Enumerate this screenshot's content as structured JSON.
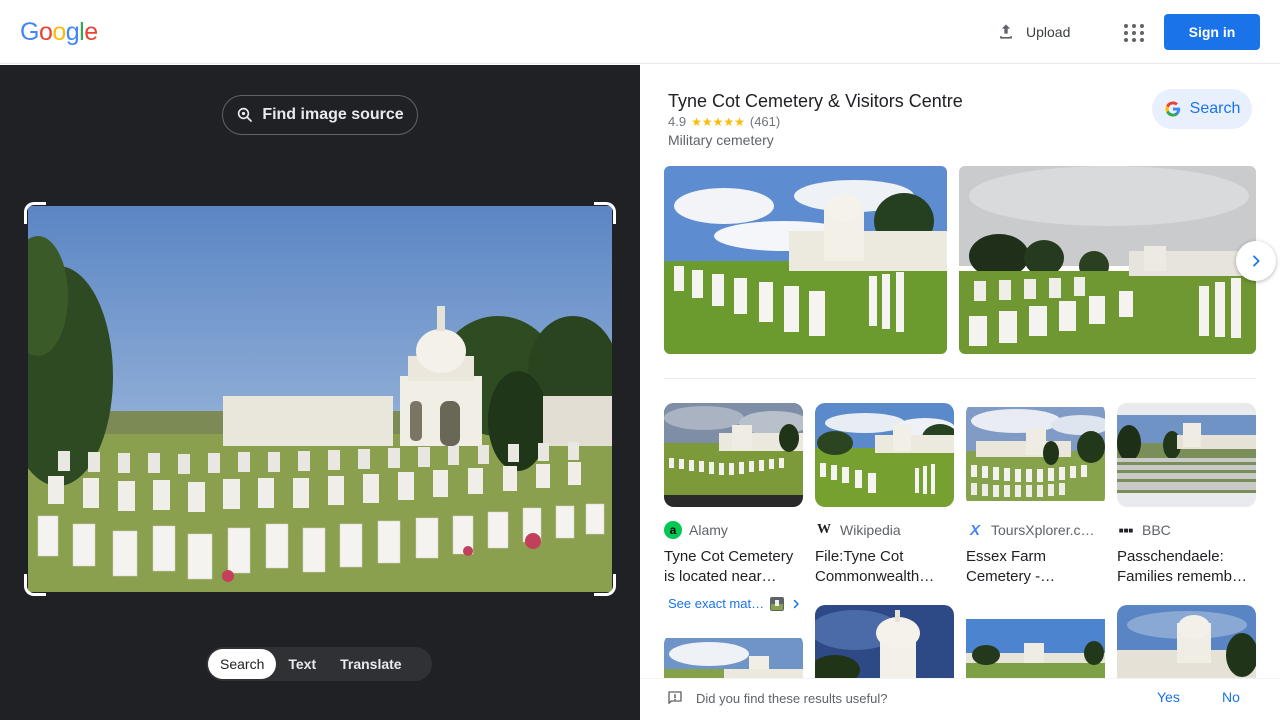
{
  "header": {
    "logo_letters": [
      {
        "ch": "G",
        "color": "#4285F4"
      },
      {
        "ch": "o",
        "color": "#EA4335"
      },
      {
        "ch": "o",
        "color": "#FBBC05"
      },
      {
        "ch": "g",
        "color": "#4285F4"
      },
      {
        "ch": "l",
        "color": "#34A853"
      },
      {
        "ch": "e",
        "color": "#EA4335"
      }
    ],
    "upload_label": "Upload",
    "signin_label": "Sign in"
  },
  "left": {
    "find_source_label": "Find image source",
    "modes": [
      "Search",
      "Text",
      "Translate"
    ],
    "active_mode": "Search"
  },
  "place": {
    "title": "Tyne Cot Cemetery & Visitors Centre",
    "rating": "4.9",
    "stars": "★★★★★",
    "reviews": "(461)",
    "type": "Military cemetery",
    "search_label": "Search"
  },
  "results": [
    {
      "source": "Alamy",
      "title": "Tyne Cot Cemetery is located near…",
      "icon": "alamy-icon",
      "icon_glyph": "a",
      "icon_color": "#00c853"
    },
    {
      "source": "Wikipedia",
      "title": "File:Tyne Cot Commonwealth…",
      "icon": "wikipedia-icon",
      "icon_glyph": "W",
      "icon_color": "#ffffff"
    },
    {
      "source": "ToursXplorer.c…",
      "title": "Essex Farm Cemetery -…",
      "icon": "toursxplorer-icon",
      "icon_glyph": "X",
      "icon_color": "#ffffff"
    },
    {
      "source": "BBC",
      "title": "Passchendaele: Families rememb…",
      "icon": "bbc-icon",
      "icon_glyph": "▪▪▪",
      "icon_color": "#ffffff"
    }
  ],
  "exact_match_label": "See exact mat…",
  "feedback": {
    "question": "Did you find these results useful?",
    "yes": "Yes",
    "no": "No"
  },
  "colors": {
    "accent": "#1a73e8",
    "dark_bg": "#202124",
    "star": "#fbbc04"
  }
}
